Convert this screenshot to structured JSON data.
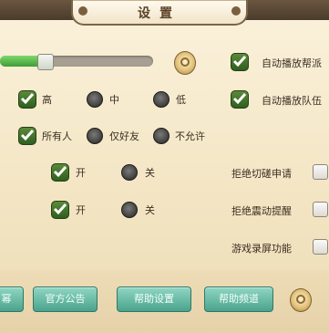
{
  "title": "设置",
  "volume": {
    "level": 0.27
  },
  "right_checks": [
    {
      "label": "自动播放帮派",
      "checked": true
    },
    {
      "label": "自动播放队伍",
      "checked": true
    }
  ],
  "quality": {
    "options": [
      "高",
      "中",
      "低"
    ],
    "selected": 0
  },
  "visibility": {
    "options": [
      "所有人",
      "仅好友",
      "不允许"
    ],
    "selected": 0
  },
  "toggle_a": {
    "on": "开",
    "off": "关",
    "selected": 0
  },
  "toggle_b": {
    "on": "开",
    "off": "关",
    "selected": 0
  },
  "right_boxes": [
    {
      "label": "拒绝切磋申请",
      "checked": false
    },
    {
      "label": "拒绝震动提醒",
      "checked": false
    },
    {
      "label": "游戏录屏功能",
      "checked": false
    }
  ],
  "bottom_buttons": [
    "幂",
    "官方公告",
    "帮助设置",
    "帮助频道"
  ],
  "colors": {
    "accent_green": "#3f9d36",
    "button_teal": "#4aa38c",
    "bar_brown": "#4a3b2b"
  },
  "icons": [
    "medal-icon",
    "check-icon",
    "radio-icon"
  ]
}
